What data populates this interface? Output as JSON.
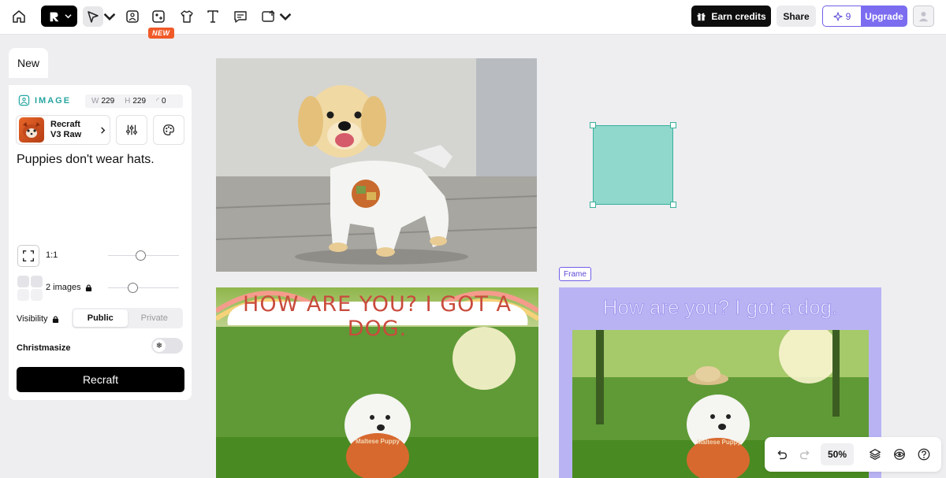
{
  "toolbar": {
    "new_badge": "NEW",
    "earn_label": "Earn credits",
    "share_label": "Share",
    "credits_count": "9",
    "upgrade_label": "Upgrade"
  },
  "panel": {
    "tab_label": "New",
    "type_label": "IMAGE",
    "width_key": "W",
    "width": "229",
    "height_key": "H",
    "height": "229",
    "radius": "0",
    "model_line1": "Recraft",
    "model_line2": "V3 Raw",
    "prompt": "Puppies don't wear hats.",
    "ratio_label": "1:1",
    "images_label": "2 images",
    "visibility_label": "Visibility",
    "visibility_options": [
      "Public",
      "Private"
    ],
    "visibility_selected": "Public",
    "christmasize_label": "Christmasize",
    "recraft_button": "Recraft"
  },
  "canvas": {
    "image2_caption": "HOW ARE YOU? I GOT A DOG.",
    "frame_label": "Frame",
    "frame_title": "How are you? I got a dog.",
    "shirt_text": "Maltese Puppy"
  },
  "controls": {
    "zoom": "50%"
  },
  "colors": {
    "accent": "#7b6cf0",
    "image_label": "#27a5a0",
    "new_badge": "#f05a28",
    "frame_bg": "#b9b3f4",
    "shape_fill": "#8fd8cb"
  }
}
